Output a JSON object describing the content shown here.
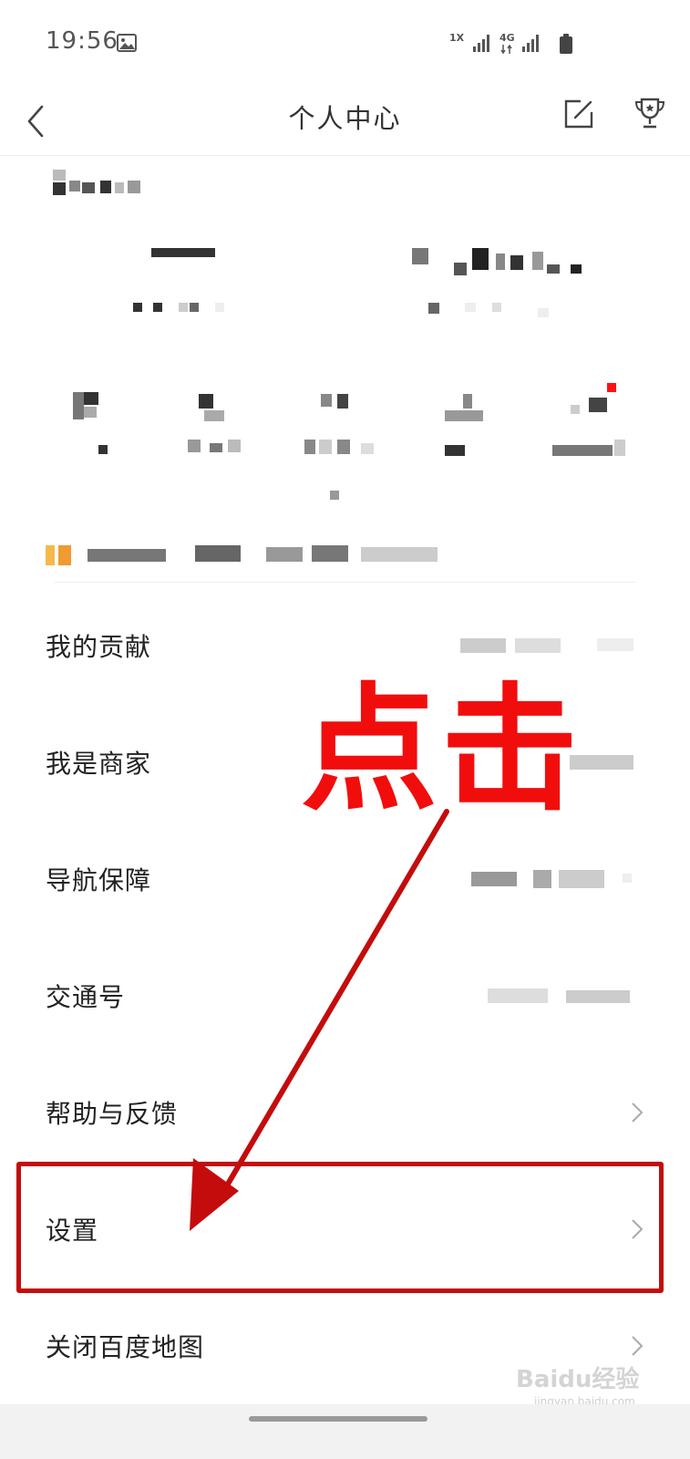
{
  "status_bar": {
    "time": "19:56",
    "net_label_1": "1X",
    "net_label_2": "4G",
    "icons": [
      "gallery-icon",
      "signal-icon",
      "signal-icon",
      "battery-icon"
    ]
  },
  "header": {
    "title": "个人中心",
    "back_icon": "chevron-left-icon",
    "edit_icon": "edit-icon",
    "trophy_icon": "trophy-icon"
  },
  "menu": {
    "items": [
      {
        "label": "我的贡献"
      },
      {
        "label": "我是商家"
      },
      {
        "label": "导航保障"
      },
      {
        "label": "交通号"
      },
      {
        "label": "帮助与反馈"
      },
      {
        "label": "设置"
      },
      {
        "label": "关闭百度地图"
      }
    ]
  },
  "annotation": {
    "text": "点击",
    "color": "#f20d0d",
    "box_color": "#c40c0c"
  },
  "watermark": {
    "text": "Baidu经验",
    "sub": "jingyan.baidu.com"
  }
}
